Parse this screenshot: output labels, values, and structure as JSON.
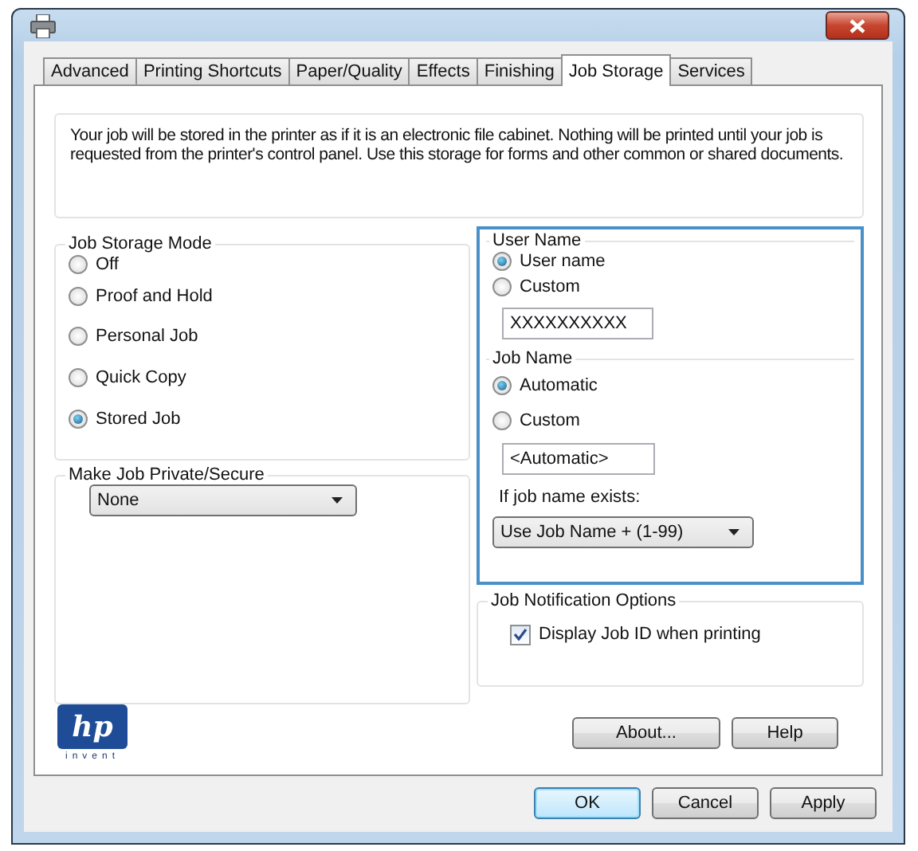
{
  "tabs": [
    {
      "label": "Advanced",
      "selected": false
    },
    {
      "label": "Printing Shortcuts",
      "selected": false
    },
    {
      "label": "Paper/Quality",
      "selected": false
    },
    {
      "label": "Effects",
      "selected": false
    },
    {
      "label": "Finishing",
      "selected": false
    },
    {
      "label": "Job Storage",
      "selected": true
    },
    {
      "label": "Services",
      "selected": false
    }
  ],
  "description": "Your job will be stored in the printer as if it is an electronic file cabinet. Nothing will be printed until your job is requested from the printer's control panel. Use this storage for forms and other common or shared documents.",
  "storage_mode": {
    "label": "Job Storage Mode",
    "options": [
      {
        "label": "Off",
        "selected": false
      },
      {
        "label": "Proof and Hold",
        "selected": false
      },
      {
        "label": "Personal Job",
        "selected": false
      },
      {
        "label": "Quick Copy",
        "selected": false
      },
      {
        "label": "Stored Job",
        "selected": true
      }
    ]
  },
  "privacy": {
    "label": "Make Job Private/Secure",
    "dropdown": {
      "value": "None"
    }
  },
  "user_name": {
    "label": "User Name",
    "options": [
      {
        "label": "User name",
        "selected": true
      },
      {
        "label": "Custom",
        "selected": false
      }
    ],
    "field": {
      "value": "XXXXXXXXXX"
    }
  },
  "job_name": {
    "label": "Job Name",
    "options": [
      {
        "label": "Automatic",
        "selected": true
      },
      {
        "label": "Custom",
        "selected": false
      }
    ],
    "field": {
      "value": "<Automatic>"
    },
    "exists_label": "If job name exists:",
    "exists_dropdown": {
      "value": "Use Job Name + (1-99)"
    }
  },
  "notification": {
    "label": "Job Notification Options",
    "checkbox": {
      "label": "Display Job ID when printing",
      "checked": true
    }
  },
  "logo": {
    "mark": "hp",
    "tagline": "invent"
  },
  "panel_buttons": [
    {
      "label": "About..."
    },
    {
      "label": "Help"
    }
  ],
  "dialog_buttons": [
    {
      "label": "OK",
      "default": true
    },
    {
      "label": "Cancel",
      "default": false
    },
    {
      "label": "Apply",
      "default": false
    }
  ]
}
